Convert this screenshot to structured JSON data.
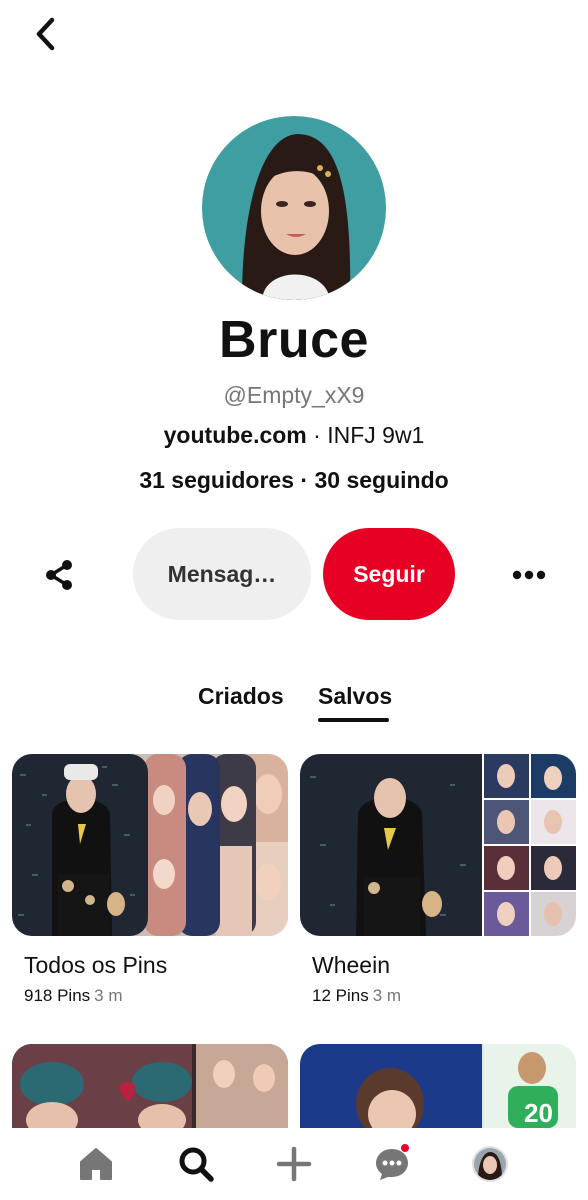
{
  "header": {
    "back_icon": "chevron-left-icon"
  },
  "profile": {
    "avatar_icon": "profile-photo",
    "name": "Bruce",
    "username": "@Empty_xX9",
    "website": "youtube.com",
    "bio_separator": " · ",
    "bio": "INFJ 9w1",
    "followers": "31 seguidores",
    "stats_separator": " · ",
    "following": "30 seguindo"
  },
  "actions": {
    "share_icon": "share-icon",
    "message_label": "Mensag…",
    "follow_label": "Seguir",
    "more_icon": "more-horizontal-icon"
  },
  "tabs": [
    {
      "label": "Criados",
      "active": false
    },
    {
      "label": "Salvos",
      "active": true
    }
  ],
  "boards": [
    {
      "title": "Todos os Pins",
      "pins": "918 Pins",
      "age": "3 m"
    },
    {
      "title": "Wheein",
      "pins": "12 Pins",
      "age": "3 m"
    }
  ],
  "bottom_nav": [
    {
      "name": "home",
      "icon": "home-icon"
    },
    {
      "name": "search",
      "icon": "search-icon",
      "active": true
    },
    {
      "name": "create",
      "icon": "plus-icon"
    },
    {
      "name": "messages",
      "icon": "chat-icon",
      "has_notification": true
    },
    {
      "name": "profile",
      "icon": "avatar-icon"
    }
  ],
  "colors": {
    "accent": "#e60023",
    "button_gray": "#efefef",
    "text_primary": "#111111",
    "text_secondary": "#767676"
  }
}
